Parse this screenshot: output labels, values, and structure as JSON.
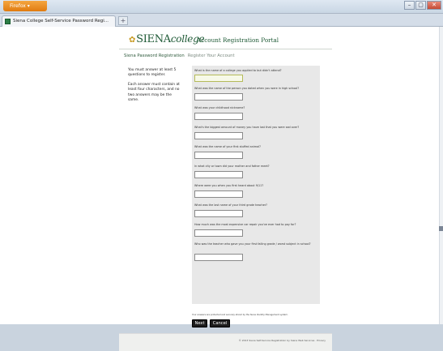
{
  "browser": {
    "menu_button": "Firefox",
    "tab_title": "Siena College Self-Service Password Regi...",
    "new_tab": "+",
    "min": "–",
    "max": "▢",
    "close": "✕"
  },
  "header": {
    "logo_main": "SIENA",
    "logo_italic": "college",
    "portal_title": "Account Registration Portal"
  },
  "breadcrumb": {
    "main": "Siena Password Registration",
    "sub": "Register Your Account"
  },
  "instructions": [
    "You must answer at least 5 questions to register.",
    "Each answer must contain at least four characters, and no two answers may be the same."
  ],
  "questions": [
    "What is the name of a college you applied to but didn't attend?",
    "What was the name of the person you dated when you were in high school?",
    "What was your childhood nickname?",
    "What's the biggest amount of money you have lost that you were sad over?",
    "What was the name of your first stuffed animal?",
    "In what city or town did your mother and father meet?",
    "Where were you when you first heard about 9/11?",
    "What was the last name of your third grade teacher?",
    "How much was the most expensive car repair you've ever had to pay for?",
    "Who was the teacher who gave you your first failing grade / worst subject in school?"
  ],
  "disclaimer": "Your answers are protected and securely stored by the Siena Identity Management system.",
  "buttons": {
    "next": "Next",
    "cancel": "Cancel"
  },
  "footer": "© 2013 Siena Self-Service Registration by Siena Web Services · Privacy"
}
